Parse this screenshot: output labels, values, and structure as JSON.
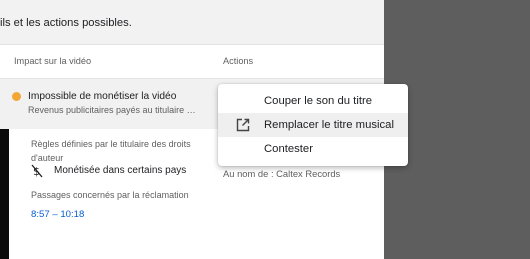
{
  "notice": {
    "text": "ils et les actions possibles."
  },
  "table": {
    "headers": {
      "impact": "Impact sur la vidéo",
      "actions": "Actions"
    }
  },
  "claim": {
    "status_color": "#f2a633",
    "impact_title": "Impossible de monétiser la vidéo",
    "impact_sub": "Revenus publicitaires payés au titulaire d...",
    "rules_label": "Règles définies par le titulaire des droits d'auteur",
    "monetization": {
      "icon": "no-money-icon",
      "text": "Monétisée dans certains pays"
    },
    "passages_label": "Passages concernés par la réclamation",
    "passage_range": "8:57 – 10:18",
    "owner": "Au nom de : Caltex Records"
  },
  "menu": {
    "items": [
      {
        "label": "Couper le son du titre",
        "icon": ""
      },
      {
        "label": "Remplacer le titre musical",
        "icon": "open-in-new-icon",
        "highlighted": true
      },
      {
        "label": "Contester",
        "icon": ""
      }
    ]
  },
  "colors": {
    "link": "#065fd4",
    "accent_dot": "#f2a633"
  }
}
